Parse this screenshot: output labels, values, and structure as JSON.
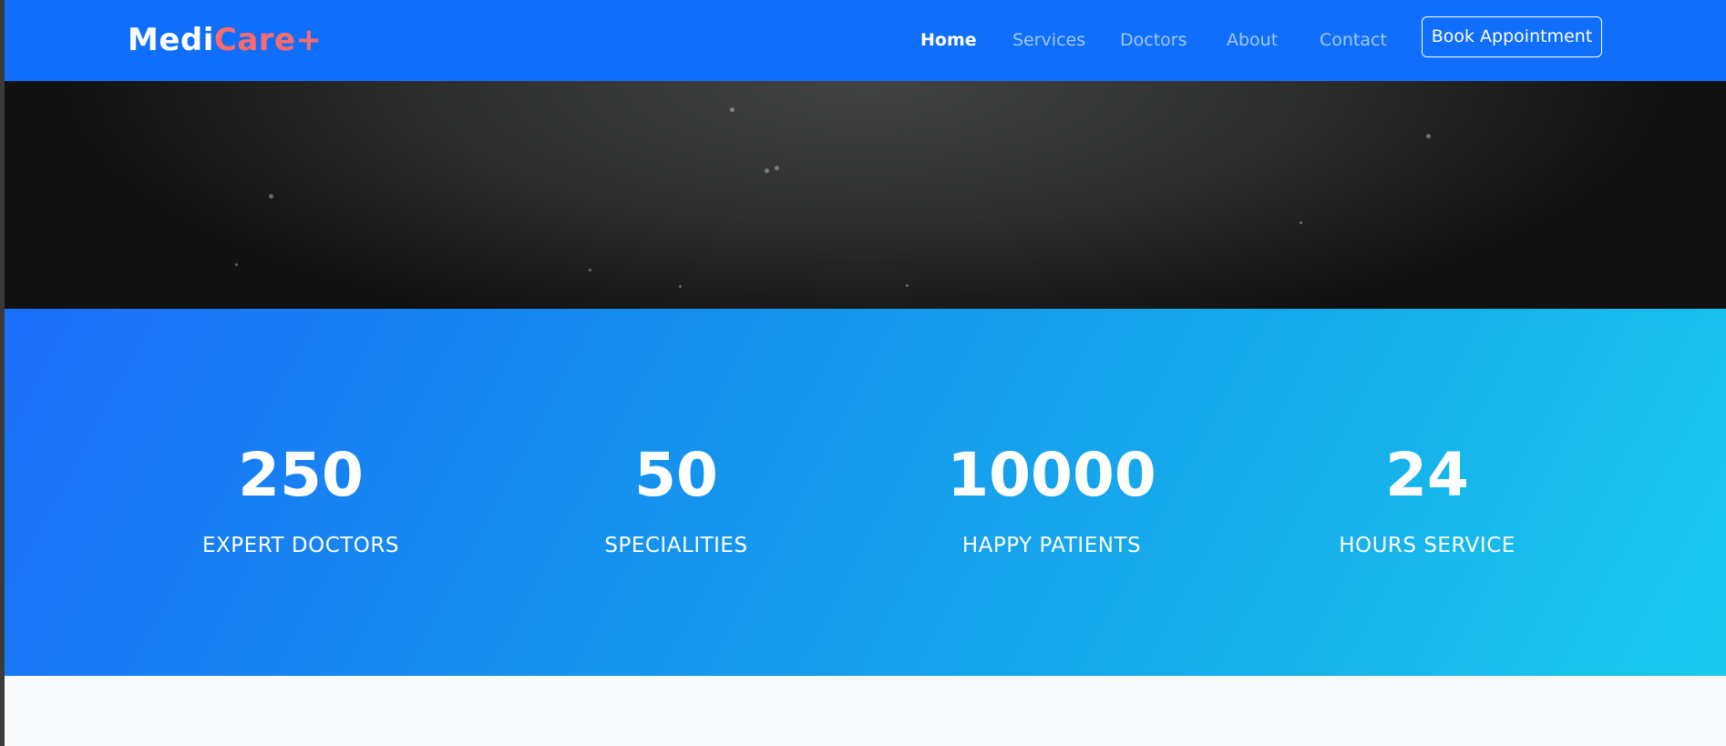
{
  "brand": {
    "name_part1": "Medi",
    "name_part2": "Care+",
    "colors": {
      "part1": "#ffffff",
      "part2": "#ff6b6b"
    }
  },
  "nav": {
    "links": [
      {
        "label": "Home",
        "active": true
      },
      {
        "label": "Services",
        "active": false
      },
      {
        "label": "Doctors",
        "active": false
      },
      {
        "label": "About",
        "active": false
      },
      {
        "label": "Contact",
        "active": false
      }
    ],
    "cta_label": "Book Appointment"
  },
  "stats": [
    {
      "number": "250",
      "label": "EXPERT DOCTORS"
    },
    {
      "number": "50",
      "label": "SPECIALITIES"
    },
    {
      "number": "10000",
      "label": "HAPPY PATIENTS"
    },
    {
      "number": "24",
      "label": "HOURS SERVICE"
    }
  ],
  "colors": {
    "navbar": "#0f6efb",
    "hero_dark": "#111111",
    "stats_gradient_start": "#1a6ef8",
    "stats_gradient_end": "#17cbee",
    "page_background": "#f8f9fa"
  }
}
